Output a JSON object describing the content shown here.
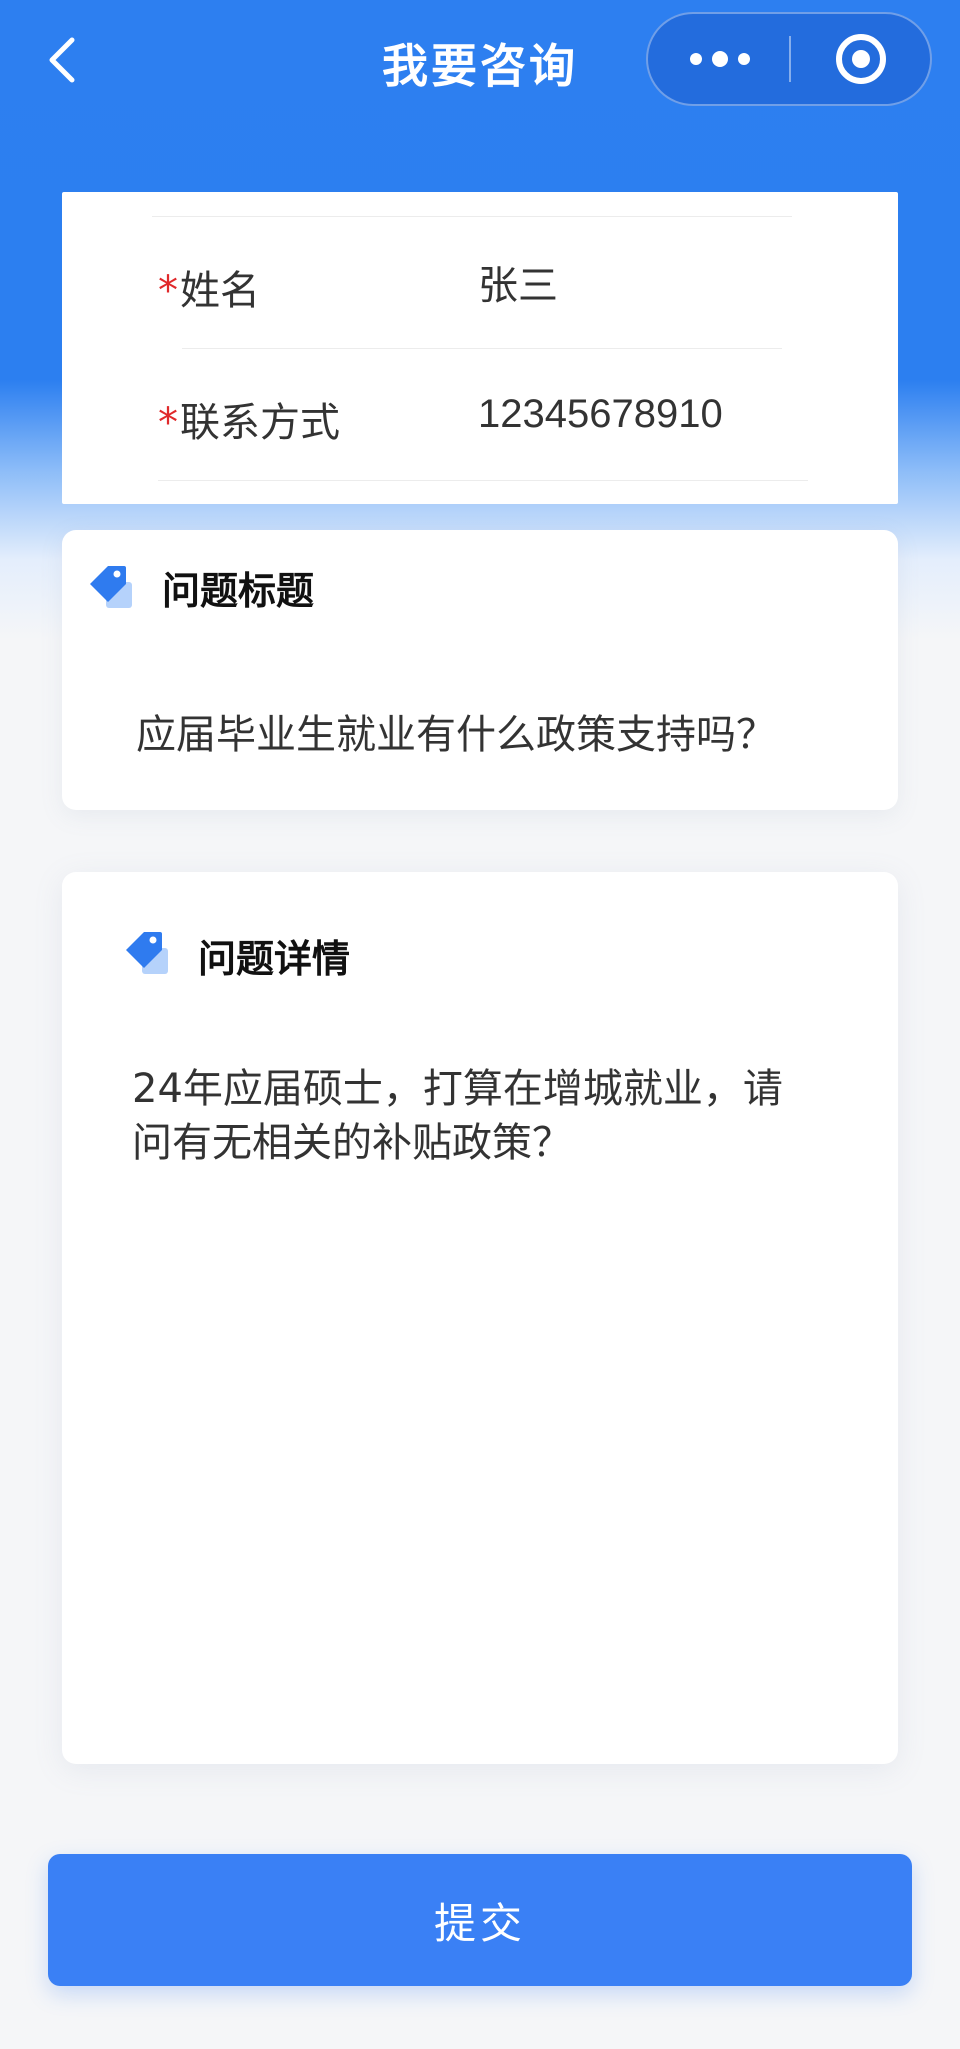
{
  "nav": {
    "title": "我要咨询",
    "back_icon": "chevron-left-icon",
    "more_icon": "more-dots-icon",
    "close_icon": "target-circle-icon"
  },
  "contact_form": {
    "required_mark": "*",
    "name_label": "姓名",
    "name_value": "张三",
    "phone_label": "联系方式",
    "phone_value": "12345678910"
  },
  "question_title": {
    "icon": "tag-icon",
    "heading": "问题标题",
    "value": "应届毕业生就业有什么政策支持吗？"
  },
  "question_detail": {
    "icon": "tag-icon",
    "heading": "问题详情",
    "value": "24年应届硕士，打算在增城就业，请\n问有无相关的补贴政策？"
  },
  "submit": {
    "label": "提交"
  },
  "colors": {
    "primary": "#2d7ff0",
    "button": "#3a80f5",
    "required": "#e0292b",
    "text": "#333333"
  }
}
